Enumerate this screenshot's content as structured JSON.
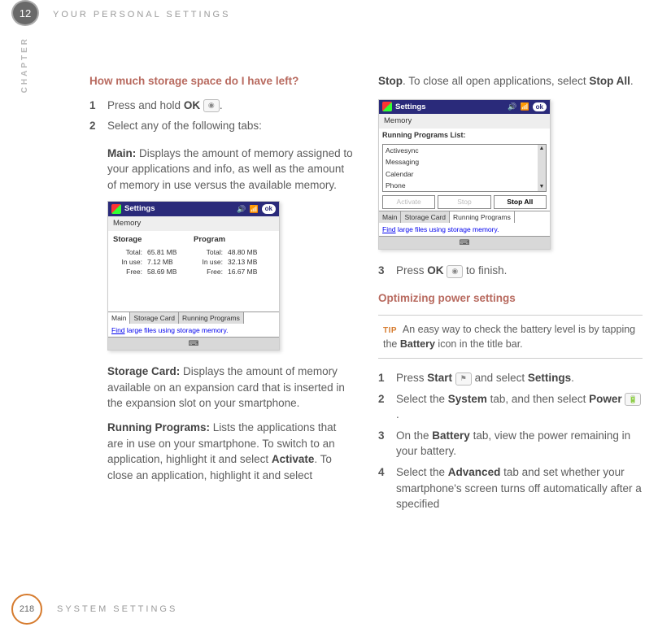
{
  "chapter": {
    "number": "12",
    "label": "CHAPTER",
    "running_head": "YOUR PERSONAL SETTINGS"
  },
  "footer": {
    "page": "218",
    "section": "SYSTEM SETTINGS"
  },
  "left": {
    "heading": "How much storage space do I have left?",
    "step1_a": "Press and hold ",
    "step1_b": "OK",
    "step1_c": ".",
    "step2": "Select any of the following tabs:",
    "main_label": "Main:",
    "main_body": " Displays the amount of memory assigned to your applications and info, as well as the amount of memory in use versus the available memory.",
    "card_label": "Storage Card:",
    "card_body": " Displays the amount of memory available on an expansion card that is inserted in the expansion slot on your smartphone.",
    "run_label": "Running Programs:",
    "run_body_1": " Lists the applications that are in use on your smartphone. To switch to an application, highlight it and select ",
    "run_bold_1": "Activate",
    "run_body_2": ". To close an application, highlight it and select"
  },
  "fig1": {
    "title": "Settings",
    "ok": "ok",
    "memory": "Memory",
    "storage_h": "Storage",
    "program_h": "Program",
    "s_total": "65.81 MB",
    "s_inuse": "7.12 MB",
    "s_free": "58.69 MB",
    "p_total": "48.80 MB",
    "p_inuse": "32.13 MB",
    "p_free": "16.67 MB",
    "lbl_total": "Total:",
    "lbl_inuse": "In use:",
    "lbl_free": "Free:",
    "tab_main": "Main",
    "tab_card": "Storage Card",
    "tab_run": "Running Programs",
    "find": "Find",
    "hint": " large files using storage memory.",
    "kbd": "⌨"
  },
  "right": {
    "cont_1a": "Stop",
    "cont_1b": ". To close all open applications, select ",
    "cont_1c": "Stop All",
    "cont_1d": ".",
    "step3_a": "Press ",
    "step3_b": "OK",
    "step3_c": " to finish.",
    "heading2": "Optimizing power settings",
    "tip_label": "TIP",
    "tip_a": "An easy way to check the battery level is by tapping the ",
    "tip_b": "Battery",
    "tip_c": " icon in the title bar.",
    "p1a": "Press ",
    "p1b": "Start",
    "p1c": " and select ",
    "p1d": "Settings",
    "p1e": ".",
    "p2a": "Select the ",
    "p2b": "System",
    "p2c": " tab, and then select ",
    "p2d": "Power",
    "p2e": ".",
    "p3a": "On the ",
    "p3b": "Battery",
    "p3c": " tab, view the power remaining in your battery.",
    "p4a": "Select the ",
    "p4b": "Advanced",
    "p4c": " tab and set whether your smartphone's screen turns off automatically after a specified"
  },
  "fig2": {
    "title": "Settings",
    "memory": "Memory",
    "list_head": "Running Programs List:",
    "items": [
      "Activesync",
      "Messaging",
      "Calendar",
      "Phone"
    ],
    "btn_activate": "Activate",
    "btn_stop": "Stop",
    "btn_stopall": "Stop All",
    "tab_main": "Main",
    "tab_card": "Storage Card",
    "tab_run": "Running Programs",
    "find": "Find",
    "hint": " large files using storage memory."
  }
}
